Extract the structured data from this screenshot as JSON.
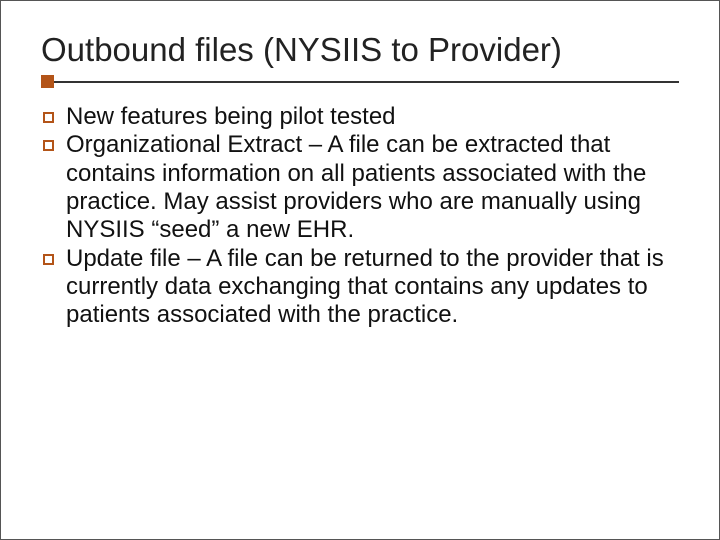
{
  "slide": {
    "title": "Outbound files (NYSIIS to Provider)",
    "bullets": [
      {
        "text": "New features being pilot tested"
      },
      {
        "text": "Organizational Extract – A file can be extracted that contains information on all patients associated with the practice.  May assist providers who are manually using NYSIIS “seed” a new EHR."
      },
      {
        "text": "Update file – A file can be returned to the provider that is currently data exchanging that contains any updates to patients associated with the practice."
      }
    ]
  },
  "colors": {
    "accent": "#b35418"
  }
}
